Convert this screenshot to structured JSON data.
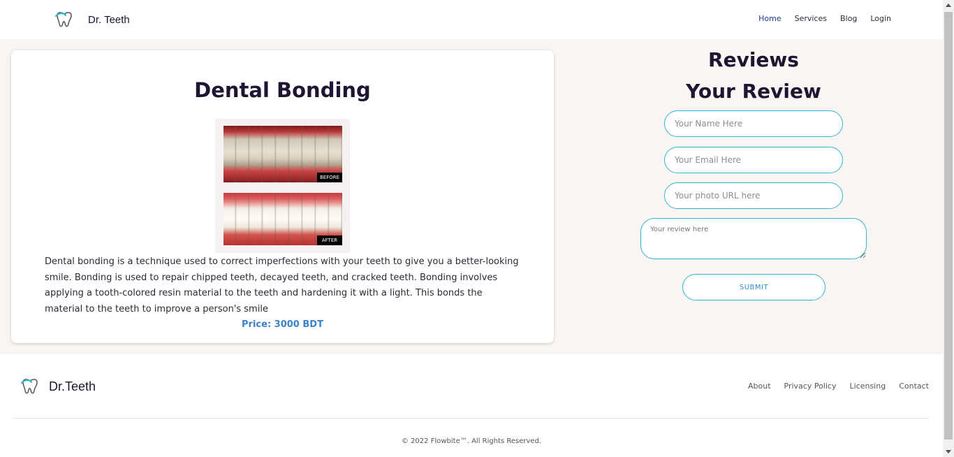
{
  "header": {
    "brand_name": "Dr. Teeth",
    "brand_icon": "tooth-logo-icon",
    "nav": [
      {
        "label": "Home",
        "active": true
      },
      {
        "label": "Services",
        "active": false
      },
      {
        "label": "Blog",
        "active": false
      },
      {
        "label": "Login",
        "active": false
      }
    ]
  },
  "service": {
    "title": "Dental Bonding",
    "image_tags": {
      "before": "BEFORE",
      "after": "AFTER"
    },
    "description": "Dental bonding is a technique used to correct imperfections with your teeth to give you a better-looking smile. Bonding is used to repair chipped teeth, decayed teeth, and cracked teeth. Bonding involves applying a tooth-colored resin material to the teeth and hardening it with a light. This bonds the material to the teeth to improve a person's smile",
    "price": "Price: 3000 BDT"
  },
  "reviews": {
    "heading": "Reviews",
    "form_heading": "Your Review",
    "name_placeholder": "Your Name Here",
    "email_placeholder": "Your Email Here",
    "photo_placeholder": "Your photo URL here",
    "review_placeholder": "Your review here",
    "submit_label": "SUBMIT"
  },
  "footer": {
    "brand_name": "Dr.Teeth",
    "links": [
      "About",
      "Privacy Policy",
      "Licensing",
      "Contact"
    ],
    "copyright": "© 2022 Flowbite™. All Rights Reserved."
  },
  "colors": {
    "accent": "#38b2d8",
    "price": "#3b82c9",
    "nav_active": "#1e3a8a",
    "page_bg": "#f8f5f2"
  }
}
